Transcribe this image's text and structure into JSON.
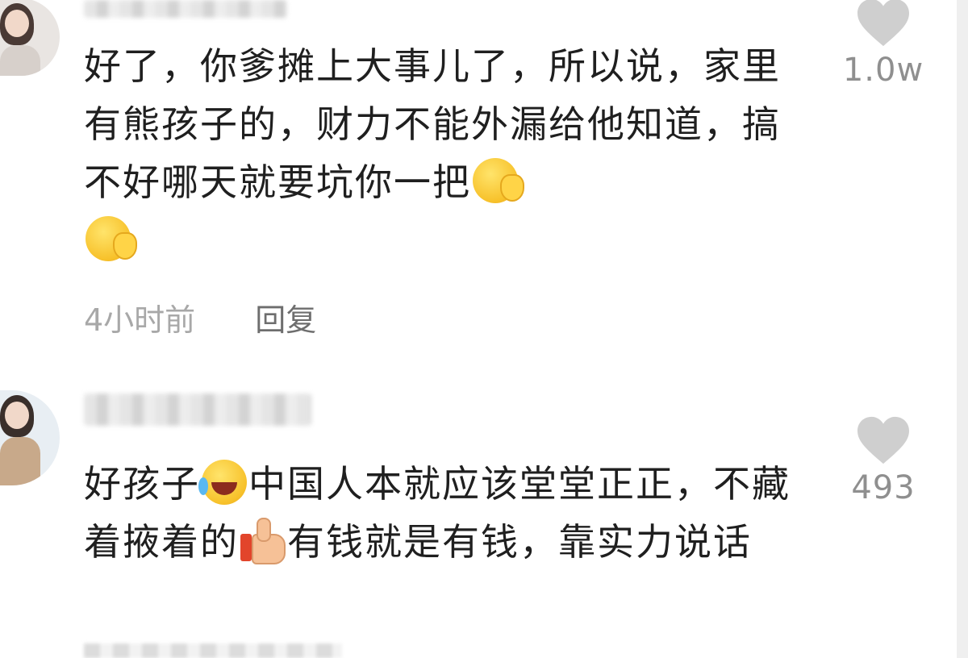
{
  "comments": [
    {
      "username": "",
      "text_parts": [
        "好了，你爹摊上大事儿了，所以说，家里有熊孩子的，财力不能外漏给他知道，搞不好哪天就要坑你一把"
      ],
      "emojis": [
        "facepalm",
        "facepalm"
      ],
      "time": "4小时前",
      "reply_label": "回复",
      "like_count": "1.0w"
    },
    {
      "username": "",
      "text_parts": [
        "好孩子",
        "中国人本就应该堂堂正正，不藏着掖着的",
        "有钱就是有钱，靠实力说话"
      ],
      "emojis": [
        "laughing-crying",
        "thumbs-up"
      ],
      "like_count": "493"
    }
  ],
  "colors": {
    "text": "#1f1f1f",
    "meta": "#a8a8a8",
    "reply": "#6e6e6e",
    "heart": "#cfcfcf",
    "count": "#8f8f8f"
  }
}
